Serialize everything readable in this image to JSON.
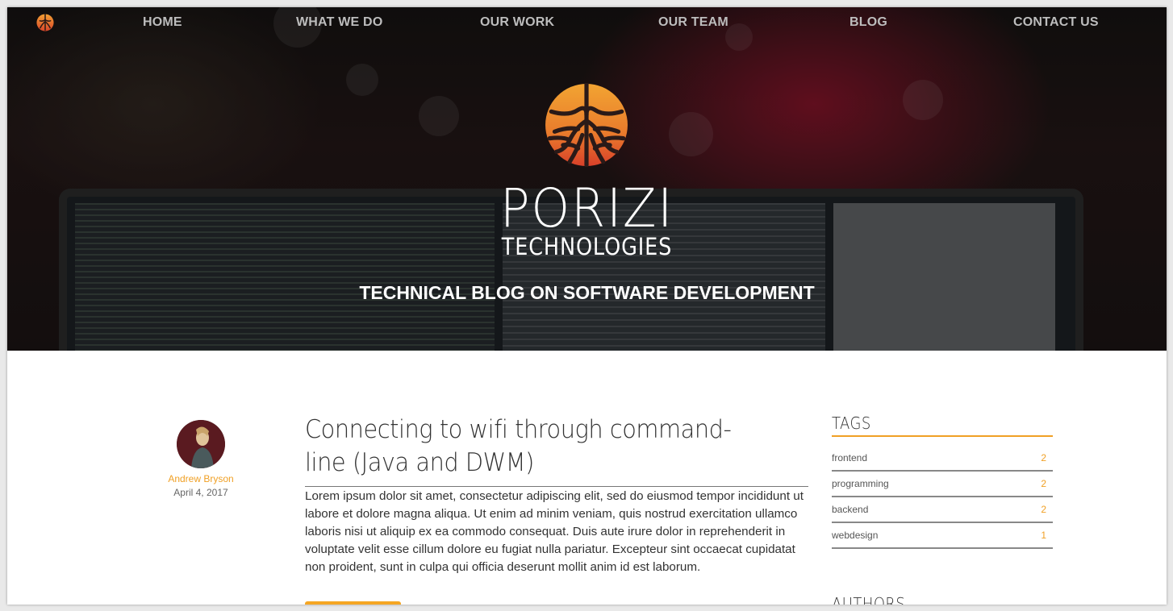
{
  "nav": {
    "logo_icon": "porizi-roots-icon",
    "items": [
      {
        "label": "HOME"
      },
      {
        "label": "WHAT WE DO"
      },
      {
        "label": "OUR WORK"
      },
      {
        "label": "OUR TEAM"
      },
      {
        "label": "BLOG"
      },
      {
        "label": "CONTACT US"
      }
    ]
  },
  "hero": {
    "emblem_icon": "porizi-roots-emblem",
    "brand_name": "PORIZI",
    "brand_sub": "TECHNOLOGIES",
    "tagline": "TECHNICAL BLOG ON SOFTWARE DEVELOPMENT"
  },
  "post": {
    "author": {
      "name": "Andrew Bryson",
      "date": "April 4, 2017"
    },
    "title": "Connecting to wifi through command-line (Java and DWM)",
    "body": "Lorem ipsum dolor sit amet, consectetur adipiscing elit, sed do eiusmod tempor incididunt ut labore et dolore magna aliqua. Ut enim ad minim veniam, quis nostrud exercitation ullamco laboris nisi ut aliquip ex ea commodo consequat. Duis aute irure dolor in reprehenderit in voluptate velit esse cillum dolore eu fugiat nulla pariatur. Excepteur sint occaecat cupidatat non proident, sunt in culpa qui officia deserunt mollit anim id est laborum."
  },
  "sidebar": {
    "tags_heading": "TAGS",
    "tags": [
      {
        "name": "frontend",
        "count": "2"
      },
      {
        "name": "programming",
        "count": "2"
      },
      {
        "name": "backend",
        "count": "2"
      },
      {
        "name": "webdesign",
        "count": "1"
      }
    ],
    "authors_heading": "AUTHORS"
  },
  "colors": {
    "accent": "#f0a025",
    "nav_text": "#bdbdbd",
    "text": "#333333"
  }
}
